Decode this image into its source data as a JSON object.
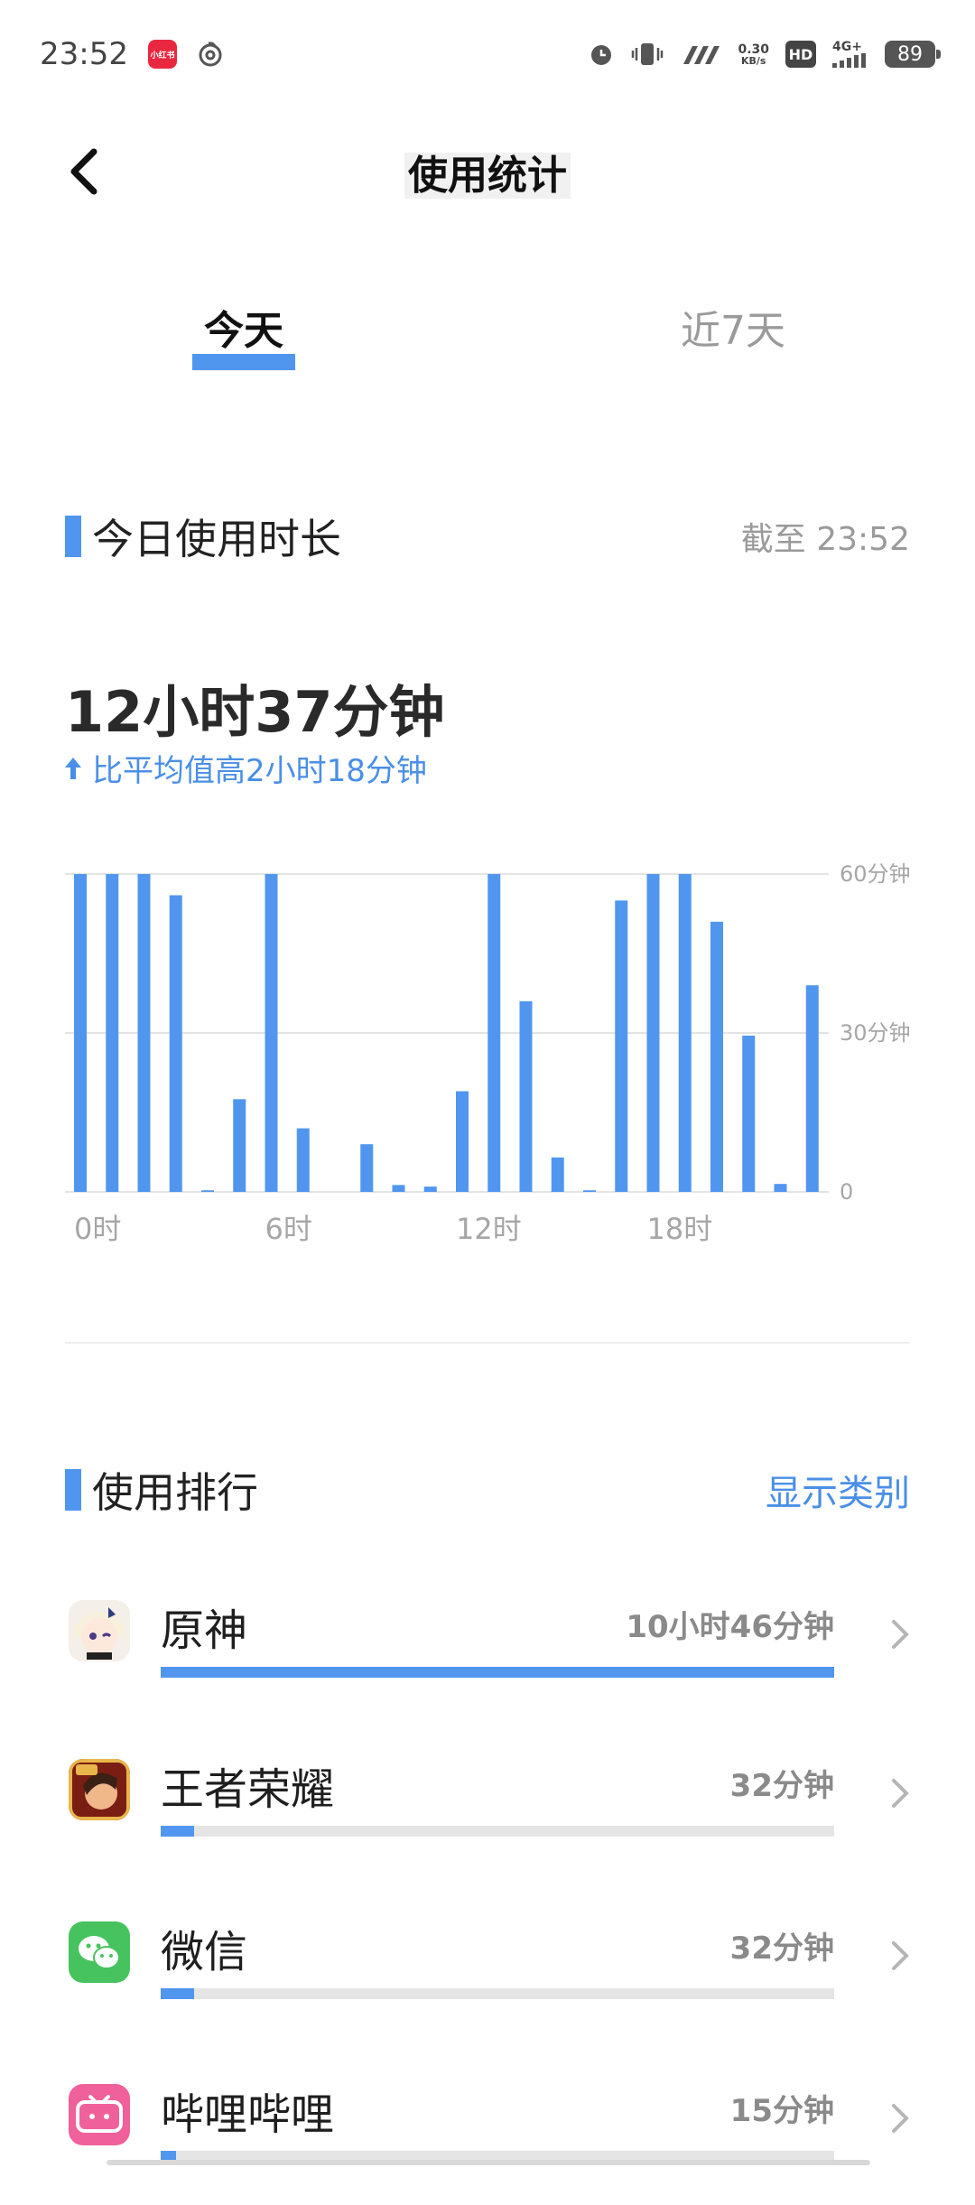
{
  "status_bar": {
    "time": "23:52",
    "mini_app_label": "小红书",
    "net_speed_value": "0.30",
    "net_speed_unit": "KB/s",
    "hd_label": "HD",
    "network_type": "4G+",
    "battery_level": "89"
  },
  "header": {
    "title": "使用统计"
  },
  "tabs": [
    {
      "label": "今天",
      "active": true
    },
    {
      "label": "近7天",
      "active": false
    }
  ],
  "today_section": {
    "title": "今日使用时长",
    "as_of": "截至 23:52",
    "total": "12小时37分钟",
    "compare_text": "比平均值高2小时18分钟"
  },
  "chart_data": {
    "type": "bar",
    "title": "",
    "xlabel": "",
    "ylabel": "",
    "categories": [
      "0",
      "1",
      "2",
      "3",
      "4",
      "5",
      "6",
      "7",
      "8",
      "9",
      "10",
      "11",
      "12",
      "13",
      "14",
      "15",
      "16",
      "17",
      "18",
      "19",
      "20",
      "21",
      "22",
      "23"
    ],
    "x_tick_labels": [
      {
        "index": 0,
        "label": "0时"
      },
      {
        "index": 6,
        "label": "6时"
      },
      {
        "index": 12,
        "label": "12时"
      },
      {
        "index": 18,
        "label": "18时"
      }
    ],
    "y_tick_labels": [
      "0",
      "30分钟",
      "60分钟"
    ],
    "y_ticks": [
      0,
      30,
      60
    ],
    "ylim": [
      0,
      60
    ],
    "grid": true,
    "values": [
      60,
      60,
      60,
      56,
      0.3,
      17.5,
      60,
      12,
      0,
      9,
      1.3,
      1,
      19,
      60,
      36,
      6.5,
      0.3,
      55,
      60,
      60,
      51,
      29.5,
      1.5,
      39
    ],
    "bar_color": "#5096ef"
  },
  "ranking": {
    "title": "使用排行",
    "action_label": "显示类别",
    "items": [
      {
        "name": "原神",
        "time": "10小时46分钟",
        "minutes": 646,
        "icon": "genshin-icon"
      },
      {
        "name": "王者荣耀",
        "time": "32分钟",
        "minutes": 32,
        "icon": "honor-of-kings-icon"
      },
      {
        "name": "微信",
        "time": "32分钟",
        "minutes": 32,
        "icon": "wechat-icon"
      },
      {
        "name": "哔哩哔哩",
        "time": "15分钟",
        "minutes": 15,
        "icon": "bilibili-icon"
      }
    ]
  },
  "colors": {
    "accent": "#5096ef",
    "link": "#4a8fe7",
    "track": "#e5e5e5"
  }
}
